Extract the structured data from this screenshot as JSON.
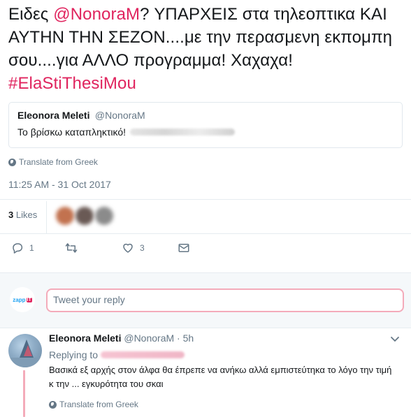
{
  "tweet": {
    "text_pre": "Ειδες ",
    "mention": "@NonoraM",
    "text_mid": "?  ΥΠΑΡΧΕΙΣ στα τηλεοπτικα ΚΑΙ ΑΥΤΗΝ ΤΗΝ ΣΕΖΟΝ....με την περασμενη εκπομπη σου....για ΑΛΛΟ προγραμμα! Χαχαχα! ",
    "hashtag": "#ElaStiThesiMou"
  },
  "quote": {
    "name": "Eleonora Meleti",
    "handle": "@NonoraM",
    "text": "Το βρίσκω καταπληκτικό!"
  },
  "translate_label": "Translate from Greek",
  "timestamp": "11:25 AM - 31 Oct 2017",
  "likes": {
    "count": "3",
    "label": "Likes"
  },
  "actions": {
    "reply_count": "1",
    "retweet_count": "",
    "like_count": "3",
    "icons": [
      "reply-icon",
      "retweet-icon",
      "heart-icon",
      "envelope-icon"
    ]
  },
  "reply_box": {
    "logo_text": "zapp",
    "logo_tag": "IT",
    "placeholder": "Tweet your reply"
  },
  "reply": {
    "name": "Eleonora Meleti",
    "meta": "@NonoraM · 5h",
    "replying_to": "Replying to",
    "text": "Βασικά εξ αρχής στον άλφα θα έπρεπε να ανήκω αλλά εμπιστεύτηκα το λόγο την τιμή κ την ... εγκυρότητα του σκαι",
    "translate_label": "Translate from Greek"
  },
  "colors": {
    "accent": "#e0245e",
    "secondary_text": "#657786",
    "reply_border": "#f4abba",
    "divider": "#e6ecf0"
  }
}
